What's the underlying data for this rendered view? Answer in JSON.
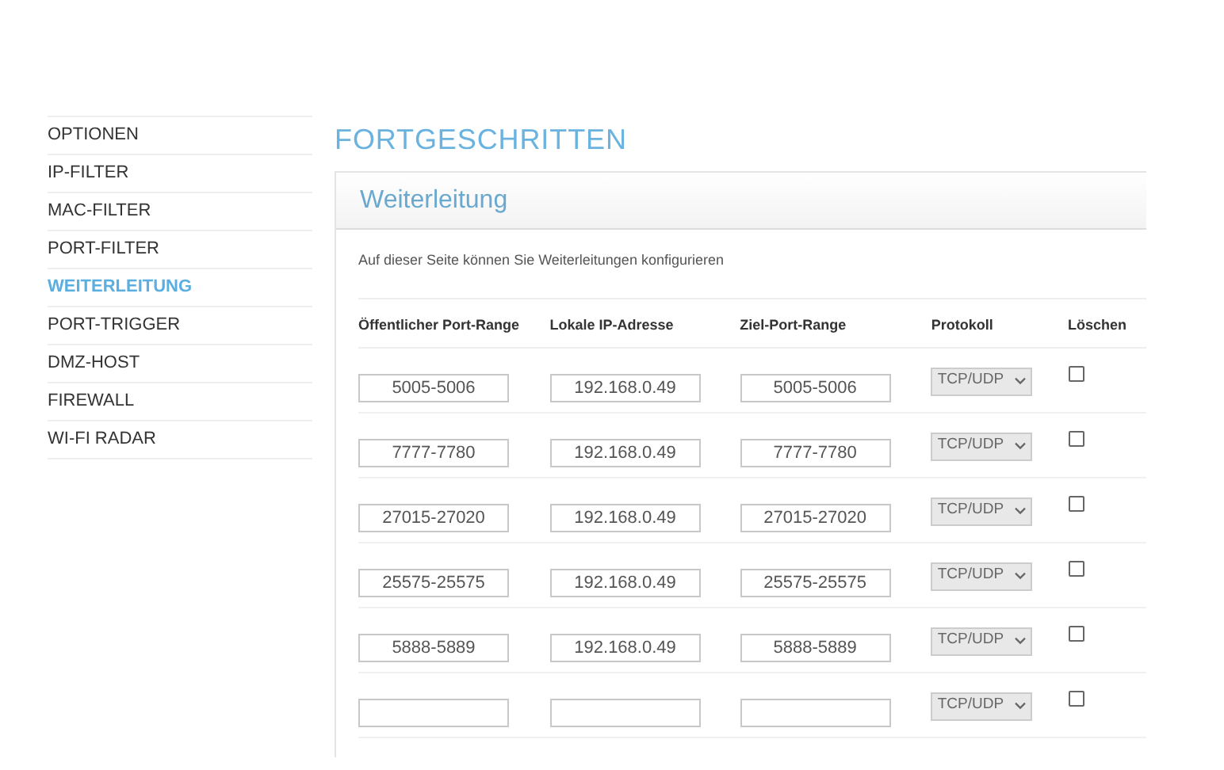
{
  "sidebar": {
    "items": [
      {
        "label": "OPTIONEN",
        "selected": false
      },
      {
        "label": "IP-FILTER",
        "selected": false
      },
      {
        "label": "MAC-FILTER",
        "selected": false
      },
      {
        "label": "PORT-FILTER",
        "selected": false
      },
      {
        "label": "WEITERLEITUNG",
        "selected": true
      },
      {
        "label": "PORT-TRIGGER",
        "selected": false
      },
      {
        "label": "DMZ-HOST",
        "selected": false
      },
      {
        "label": "FIREWALL",
        "selected": false
      },
      {
        "label": "WI-FI RADAR",
        "selected": false
      }
    ]
  },
  "page_title": "FORTGESCHRITTEN",
  "panel": {
    "title": "Weiterleitung",
    "description": "Auf dieser Seite können Sie Weiterleitungen konfigurieren",
    "table": {
      "columns": [
        "Öffentlicher Port-Range",
        "Lokale IP-Adresse",
        "Ziel-Port-Range",
        "Protokoll",
        "Löschen"
      ],
      "rows": [
        {
          "public_range": "5005-5006",
          "local_ip": "192.168.0.49",
          "target_range": "5005-5006",
          "protocol": "TCP/UDP",
          "delete": false
        },
        {
          "public_range": "7777-7780",
          "local_ip": "192.168.0.49",
          "target_range": "7777-7780",
          "protocol": "TCP/UDP",
          "delete": false
        },
        {
          "public_range": "27015-27020",
          "local_ip": "192.168.0.49",
          "target_range": "27015-27020",
          "protocol": "TCP/UDP",
          "delete": false
        },
        {
          "public_range": "25575-25575",
          "local_ip": "192.168.0.49",
          "target_range": "25575-25575",
          "protocol": "TCP/UDP",
          "delete": false
        },
        {
          "public_range": "5888-5889",
          "local_ip": "192.168.0.49",
          "target_range": "5888-5889",
          "protocol": "TCP/UDP",
          "delete": false
        },
        {
          "protocol": "TCP/UDP",
          "delete": false
        }
      ]
    }
  }
}
